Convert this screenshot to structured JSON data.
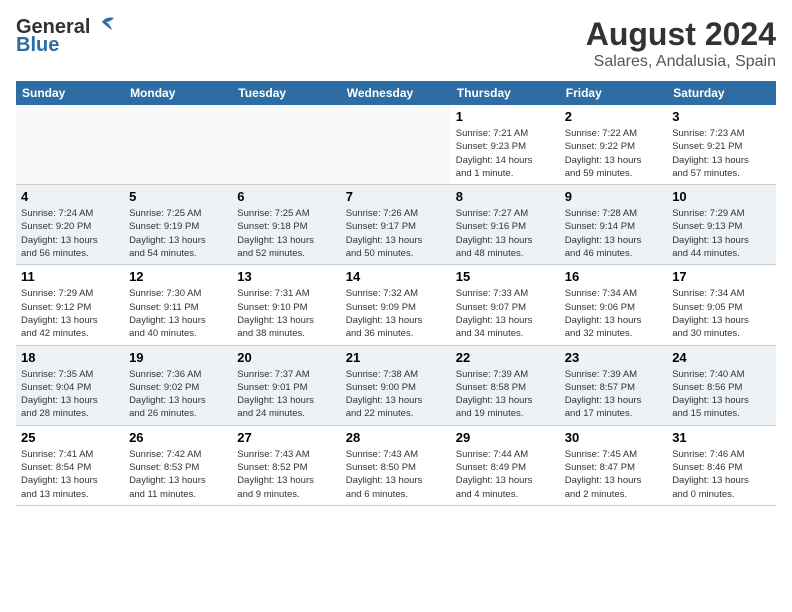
{
  "logo": {
    "general": "General",
    "blue": "Blue"
  },
  "title": "August 2024",
  "subtitle": "Salares, Andalusia, Spain",
  "weekdays": [
    "Sunday",
    "Monday",
    "Tuesday",
    "Wednesday",
    "Thursday",
    "Friday",
    "Saturday"
  ],
  "weeks": [
    [
      {
        "day": "",
        "info": ""
      },
      {
        "day": "",
        "info": ""
      },
      {
        "day": "",
        "info": ""
      },
      {
        "day": "",
        "info": ""
      },
      {
        "day": "1",
        "info": "Sunrise: 7:21 AM\nSunset: 9:23 PM\nDaylight: 14 hours\nand 1 minute."
      },
      {
        "day": "2",
        "info": "Sunrise: 7:22 AM\nSunset: 9:22 PM\nDaylight: 13 hours\nand 59 minutes."
      },
      {
        "day": "3",
        "info": "Sunrise: 7:23 AM\nSunset: 9:21 PM\nDaylight: 13 hours\nand 57 minutes."
      }
    ],
    [
      {
        "day": "4",
        "info": "Sunrise: 7:24 AM\nSunset: 9:20 PM\nDaylight: 13 hours\nand 56 minutes."
      },
      {
        "day": "5",
        "info": "Sunrise: 7:25 AM\nSunset: 9:19 PM\nDaylight: 13 hours\nand 54 minutes."
      },
      {
        "day": "6",
        "info": "Sunrise: 7:25 AM\nSunset: 9:18 PM\nDaylight: 13 hours\nand 52 minutes."
      },
      {
        "day": "7",
        "info": "Sunrise: 7:26 AM\nSunset: 9:17 PM\nDaylight: 13 hours\nand 50 minutes."
      },
      {
        "day": "8",
        "info": "Sunrise: 7:27 AM\nSunset: 9:16 PM\nDaylight: 13 hours\nand 48 minutes."
      },
      {
        "day": "9",
        "info": "Sunrise: 7:28 AM\nSunset: 9:14 PM\nDaylight: 13 hours\nand 46 minutes."
      },
      {
        "day": "10",
        "info": "Sunrise: 7:29 AM\nSunset: 9:13 PM\nDaylight: 13 hours\nand 44 minutes."
      }
    ],
    [
      {
        "day": "11",
        "info": "Sunrise: 7:29 AM\nSunset: 9:12 PM\nDaylight: 13 hours\nand 42 minutes."
      },
      {
        "day": "12",
        "info": "Sunrise: 7:30 AM\nSunset: 9:11 PM\nDaylight: 13 hours\nand 40 minutes."
      },
      {
        "day": "13",
        "info": "Sunrise: 7:31 AM\nSunset: 9:10 PM\nDaylight: 13 hours\nand 38 minutes."
      },
      {
        "day": "14",
        "info": "Sunrise: 7:32 AM\nSunset: 9:09 PM\nDaylight: 13 hours\nand 36 minutes."
      },
      {
        "day": "15",
        "info": "Sunrise: 7:33 AM\nSunset: 9:07 PM\nDaylight: 13 hours\nand 34 minutes."
      },
      {
        "day": "16",
        "info": "Sunrise: 7:34 AM\nSunset: 9:06 PM\nDaylight: 13 hours\nand 32 minutes."
      },
      {
        "day": "17",
        "info": "Sunrise: 7:34 AM\nSunset: 9:05 PM\nDaylight: 13 hours\nand 30 minutes."
      }
    ],
    [
      {
        "day": "18",
        "info": "Sunrise: 7:35 AM\nSunset: 9:04 PM\nDaylight: 13 hours\nand 28 minutes."
      },
      {
        "day": "19",
        "info": "Sunrise: 7:36 AM\nSunset: 9:02 PM\nDaylight: 13 hours\nand 26 minutes."
      },
      {
        "day": "20",
        "info": "Sunrise: 7:37 AM\nSunset: 9:01 PM\nDaylight: 13 hours\nand 24 minutes."
      },
      {
        "day": "21",
        "info": "Sunrise: 7:38 AM\nSunset: 9:00 PM\nDaylight: 13 hours\nand 22 minutes."
      },
      {
        "day": "22",
        "info": "Sunrise: 7:39 AM\nSunset: 8:58 PM\nDaylight: 13 hours\nand 19 minutes."
      },
      {
        "day": "23",
        "info": "Sunrise: 7:39 AM\nSunset: 8:57 PM\nDaylight: 13 hours\nand 17 minutes."
      },
      {
        "day": "24",
        "info": "Sunrise: 7:40 AM\nSunset: 8:56 PM\nDaylight: 13 hours\nand 15 minutes."
      }
    ],
    [
      {
        "day": "25",
        "info": "Sunrise: 7:41 AM\nSunset: 8:54 PM\nDaylight: 13 hours\nand 13 minutes."
      },
      {
        "day": "26",
        "info": "Sunrise: 7:42 AM\nSunset: 8:53 PM\nDaylight: 13 hours\nand 11 minutes."
      },
      {
        "day": "27",
        "info": "Sunrise: 7:43 AM\nSunset: 8:52 PM\nDaylight: 13 hours\nand 9 minutes."
      },
      {
        "day": "28",
        "info": "Sunrise: 7:43 AM\nSunset: 8:50 PM\nDaylight: 13 hours\nand 6 minutes."
      },
      {
        "day": "29",
        "info": "Sunrise: 7:44 AM\nSunset: 8:49 PM\nDaylight: 13 hours\nand 4 minutes."
      },
      {
        "day": "30",
        "info": "Sunrise: 7:45 AM\nSunset: 8:47 PM\nDaylight: 13 hours\nand 2 minutes."
      },
      {
        "day": "31",
        "info": "Sunrise: 7:46 AM\nSunset: 8:46 PM\nDaylight: 13 hours\nand 0 minutes."
      }
    ]
  ]
}
